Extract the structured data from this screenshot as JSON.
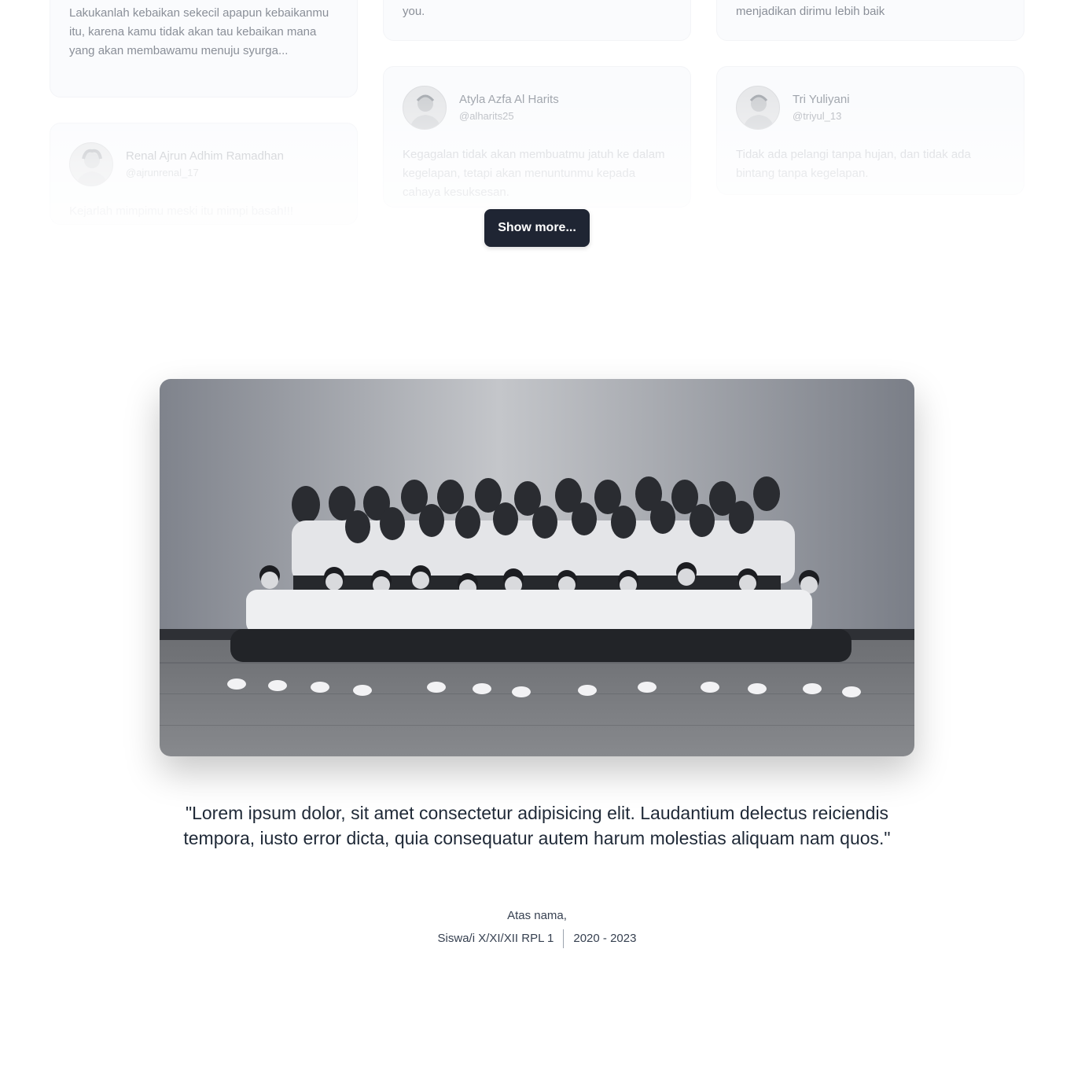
{
  "testimonials": [
    {
      "quote": "Lakukanlah kebaikan sekecil apapun kebaikanmu itu, karena kamu tidak akan tau kebaikan mana yang akan membawamu menuju syurga..."
    },
    {
      "quote": "you."
    },
    {
      "quote": "menjadikan dirimu lebih baik"
    },
    {
      "name": "Atyla Azfa Al Harits",
      "handle": "@alharits25",
      "quote": "Kegagalan tidak akan membuatmu jatuh ke dalam kegelapan, tetapi akan menuntunmu kepada cahaya kesuksesan."
    },
    {
      "name": "Tri Yuliyani",
      "handle": "@triyul_13",
      "quote": "Tidak ada pelangi tanpa hujan, dan tidak ada bintang tanpa kegelapan."
    },
    {
      "name": "Renal Ajrun Adhim Ramadhan",
      "handle": "@ajrunrenal_17",
      "quote": "Kejarlah mimpimu meski itu mimpi basah!!!"
    }
  ],
  "show_more_label": "Show more...",
  "closing": {
    "quote": "\"Lorem ipsum dolor, sit amet consectetur adipisicing elit. Laudantium delectus reiciendis tempora, iusto error dicta, quia consequatur autem harum molestias aliquam nam quos.\"",
    "on_behalf_label": "Atas nama,",
    "class_name": "Siswa/i X/XI/XII RPL 1",
    "years": "2020 - 2023"
  }
}
